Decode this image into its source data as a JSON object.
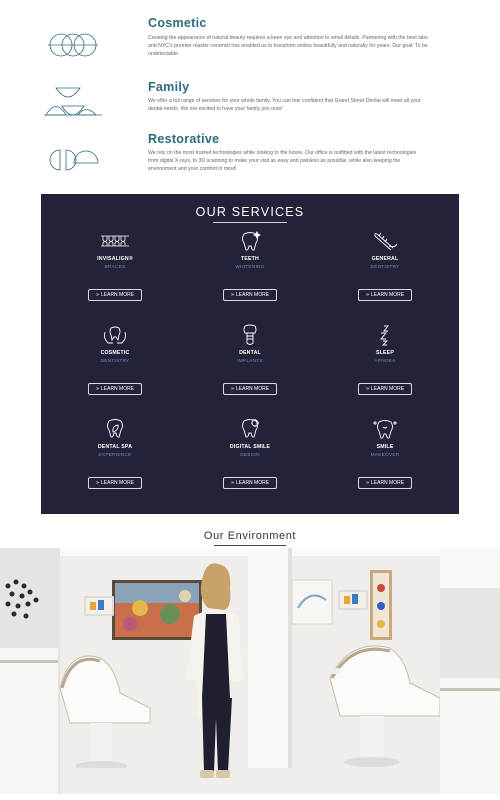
{
  "intro": [
    {
      "title": "Cosmetic",
      "icon": "interlocking-circles-icon",
      "text": "Creating the appearance of natural beauty requires a keen eye and attention to small details. Partnering with the best labs and NYC's premier master ceramist has enabled us to transform smiles beautifully and naturally for years. Our goal: To be undetectable."
    },
    {
      "title": "Family",
      "icon": "family-bowls-icon",
      "text": "We offer a full range of services for your whole family. You can feel confident that Grand Street Dental will meet all your dental needs. We are excited to have your family join ours!"
    },
    {
      "title": "Restorative",
      "icon": "half-circles-icon",
      "text": "We rely on the most trusted technologies while looking to the future. Our office is outfitted with the latest technologies from digital X-rays, to 3D scanning to make your visit as easy and painless as possible, while also keeping the environment and your comfort in mind!"
    }
  ],
  "services": {
    "heading": "OUR SERVICES",
    "button_label": "LEARN MORE",
    "items": [
      {
        "title": "INVISALIGN®",
        "subtitle": "BRACES",
        "icon": "braces-icon"
      },
      {
        "title": "TEETH",
        "subtitle": "WHITENING",
        "icon": "tooth-sparkle-icon"
      },
      {
        "title": "GENERAL",
        "subtitle": "DENTISTRY",
        "icon": "toothbrush-icon"
      },
      {
        "title": "COSMETIC",
        "subtitle": "DENTISTRY",
        "icon": "tooth-hands-icon"
      },
      {
        "title": "DENTAL",
        "subtitle": "IMPLANTS",
        "icon": "implant-icon"
      },
      {
        "title": "SLEEP",
        "subtitle": "APNOEA",
        "icon": "sleep-zzz-icon"
      },
      {
        "title": "DENTAL SPA",
        "subtitle": "EXPERIENCE",
        "icon": "tooth-leaf-icon"
      },
      {
        "title": "DIGITAL SMILE",
        "subtitle": "DESIGN",
        "icon": "tooth-gear-icon"
      },
      {
        "title": "SMILE",
        "subtitle": "MAKEOVER",
        "icon": "tooth-sparkles-icon"
      }
    ]
  },
  "environment": {
    "heading": "Our Environment"
  },
  "colors": {
    "heading_teal": "#2c6b7e",
    "services_bg": "#222238",
    "subtitle_blue": "#6f8fb8"
  }
}
